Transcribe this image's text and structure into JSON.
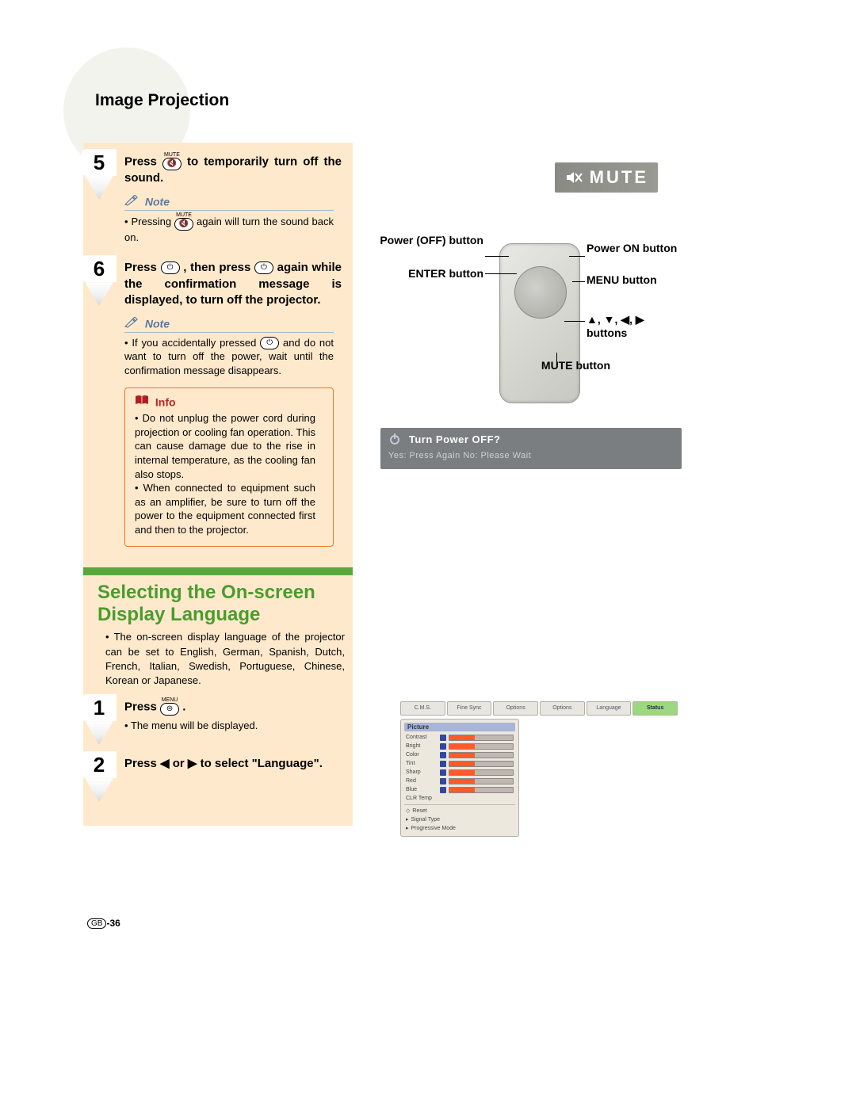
{
  "header": {
    "title": "Image Projection"
  },
  "steps": {
    "s5": {
      "num": "5",
      "line_pre": "Press ",
      "icon_top": "MUTE",
      "line_post": " to temporarily turn off the sound.",
      "note_label": "Note",
      "note_item_pre": "Pressing ",
      "note_item_post": " again will turn the sound back on."
    },
    "s6": {
      "num": "6",
      "line_a": "Press ",
      "line_b": ", then press ",
      "line_c": " again while the confirmation message is displayed, to turn off the projector.",
      "note_label": "Note",
      "note_item_a": "If you accidentally pressed ",
      "note_item_b": " and do not want to turn off the power, wait until the confirmation message disappears.",
      "info_label": "Info",
      "info_item_1": "Do not unplug the power cord during projection or cooling fan operation. This can cause damage due to the rise in internal temperature, as the cooling fan also stops.",
      "info_item_2": "When connected to equipment such as an amplifier, be sure to turn off the power to the equipment connected first and then to the projector."
    }
  },
  "section2": {
    "title": "Selecting the On-screen Display Language",
    "body": "The on-screen display language of the projector can be set to English, German, Spanish, Dutch, French, Italian, Swedish, Portuguese, Chinese, Korean or Japanese.",
    "s1": {
      "num": "1",
      "line_pre": "Press ",
      "icon_top": "MENU",
      "line_post": ".",
      "note_item": "The menu will be displayed."
    },
    "s2": {
      "num": "2",
      "line": "Press ◀ or ▶ to select \"Language\"."
    }
  },
  "right": {
    "mute_badge": "MUTE",
    "labels": {
      "power_off": "Power (OFF) button",
      "enter": "ENTER button",
      "power_on": "Power ON button",
      "menu": "MENU button",
      "arrows": "▲, ▼, ◀, ▶ buttons",
      "mute": "MUTE button"
    },
    "dialog": {
      "line1": "Turn Power OFF?",
      "line2": "Yes: Press Again   No: Please Wait"
    },
    "menu_tabs": [
      "C.M.S.",
      "Fine Sync",
      "Options",
      "Options",
      "Language",
      "Status"
    ],
    "menu_panel_title": "Picture",
    "menu_items": [
      "Contrast",
      "Bright",
      "Color",
      "Tint",
      "Sharp",
      "Red",
      "Blue",
      "CLR Temp",
      "Reset",
      "Signal Type",
      "Progressive Mode"
    ]
  },
  "page_number": "-36",
  "page_prefix": "GB"
}
